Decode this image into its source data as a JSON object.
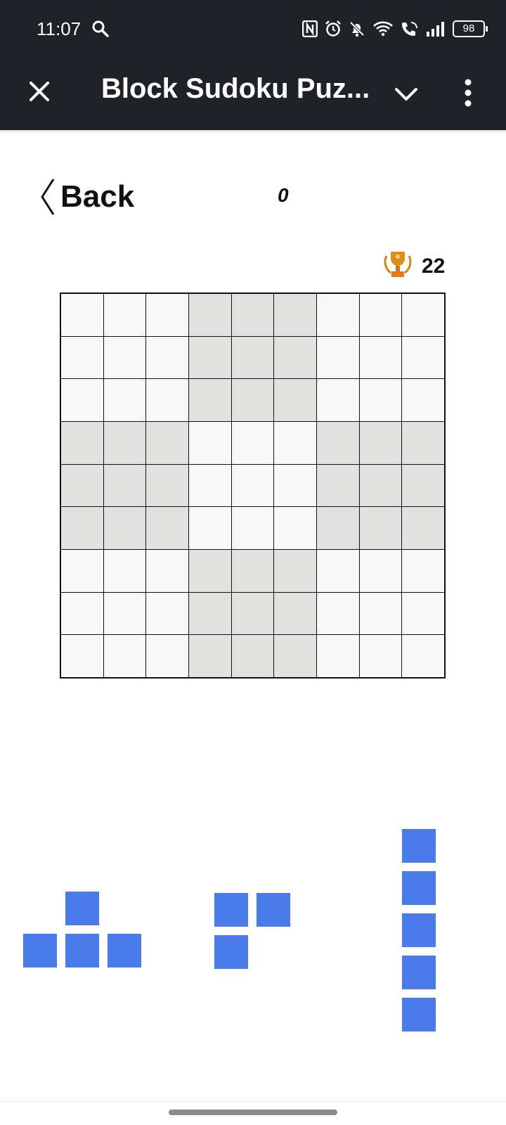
{
  "status_bar": {
    "time": "11:07",
    "battery": "98",
    "icons": [
      "search-icon",
      "nfc-icon",
      "alarm-icon",
      "mute-icon",
      "wifi-icon",
      "wifi-calling-icon",
      "signal-icon",
      "battery-icon"
    ]
  },
  "app_bar": {
    "title": "Block Sudoku Puz...",
    "icons": [
      "close-icon",
      "chevron-down-icon",
      "more-vert-icon"
    ]
  },
  "game": {
    "back_label": "Back",
    "score": "0",
    "best_score": "22",
    "best_icon": "trophy-icon"
  },
  "board": {
    "rows": 9,
    "cols": 9,
    "shaded_boxes": [
      [
        0,
        1
      ],
      [
        1,
        0
      ],
      [
        1,
        2
      ],
      [
        2,
        1
      ]
    ],
    "cell_color": "#f7f8f7",
    "shaded_color": "#e1e2e0"
  },
  "pieces": {
    "color": "#4a7be8",
    "shapes": [
      {
        "name": "t-piece",
        "cells": [
          [
            0,
            1
          ],
          [
            1,
            0
          ],
          [
            1,
            1
          ],
          [
            1,
            2
          ]
        ]
      },
      {
        "name": "l-piece",
        "cells": [
          [
            0,
            0
          ],
          [
            0,
            1
          ],
          [
            1,
            0
          ]
        ]
      },
      {
        "name": "i-piece",
        "cells": [
          [
            0,
            0
          ],
          [
            1,
            0
          ],
          [
            2,
            0
          ],
          [
            3,
            0
          ],
          [
            4,
            0
          ]
        ]
      }
    ]
  }
}
